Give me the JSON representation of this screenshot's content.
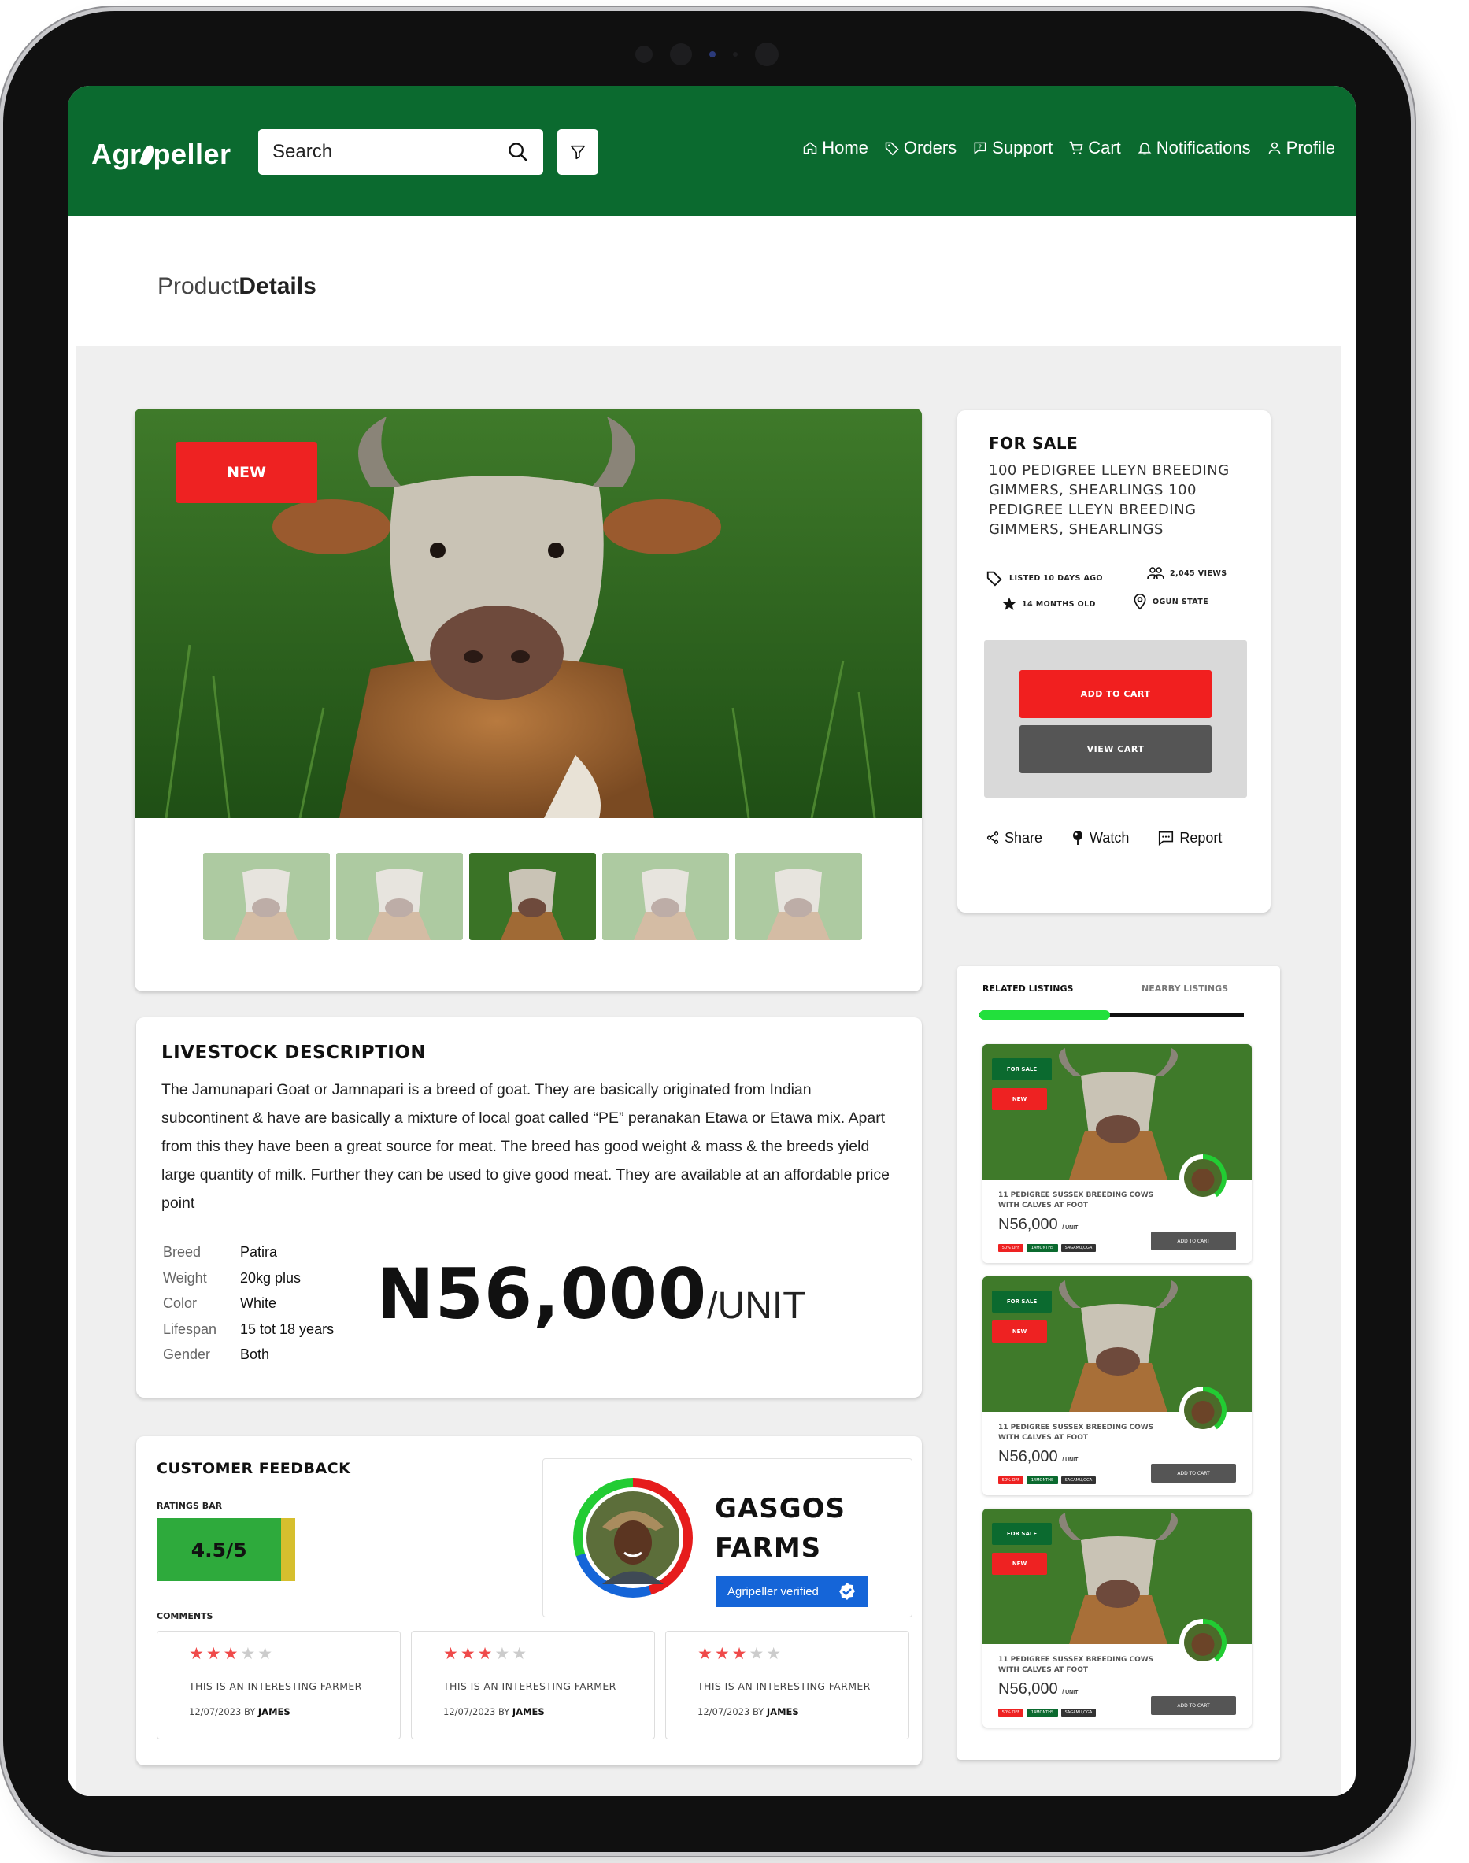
{
  "brand": {
    "logo_left": "Agr",
    "logo_right": "peller"
  },
  "header": {
    "search_placeholder": "Search",
    "nav": [
      {
        "label": "Home",
        "icon": "home-icon"
      },
      {
        "label": "Orders",
        "icon": "tag-icon"
      },
      {
        "label": "Support",
        "icon": "support-icon"
      },
      {
        "label": "Cart",
        "icon": "cart-icon"
      },
      {
        "label": "Notifications",
        "icon": "bell-icon"
      },
      {
        "label": "Profile",
        "icon": "user-icon"
      }
    ]
  },
  "page": {
    "title_light": "Product",
    "title_bold": "Details"
  },
  "gallery": {
    "badge": "NEW",
    "thumbnail_count": 5,
    "selected_thumbnail": 3
  },
  "listing": {
    "status": "FOR SALE",
    "title": "100 PEDIGREE LLEYN BREEDING GIMMERS, SHEARLINGS  100 PEDIGREE LLEYN BREEDING GIMMERS, SHEARLINGS",
    "listed": "LISTED 10 DAYS AGO",
    "views": "2,045 VIEWS",
    "age": "14 MONTHS OLD",
    "location": "OGUN STATE",
    "add_to_cart": "ADD TO CART",
    "view_cart": "VIEW CART",
    "share": "Share",
    "watch": "Watch",
    "report": "Report"
  },
  "description": {
    "heading": "LIVESTOCK DESCRIPTION",
    "text": "The Jamunapari Goat or Jamnapari is a breed of goat. They are basically originated from Indian subcontinent & have are basically a mixture of local goat called “PE” peranakan Etawa or Etawa mix. Apart from this they have been a great source for meat. The breed has good weight & mass & the breeds yield large quantity of milk. Further they can be used to give good meat. They are available at an affordable price point",
    "specs": [
      {
        "key": "Breed",
        "value": "Patira"
      },
      {
        "key": "Weight",
        "value": "20kg plus"
      },
      {
        "key": "Color",
        "value": "White"
      },
      {
        "key": "Lifespan",
        "value": "15 tot 18 years"
      },
      {
        "key": "Gender",
        "value": "Both"
      }
    ],
    "price": "N56,000",
    "unit": "/UNIT"
  },
  "feedback": {
    "heading": "CUSTOMER FEEDBACK",
    "ratings_label": "RATINGS BAR",
    "rating": "4.5/5",
    "rating_fraction": 0.9,
    "comments_label": "COMMENTS",
    "comments": [
      {
        "stars": 3,
        "text": "THIS IS AN INTERESTING FARMER",
        "date": "12/07/2023 BY",
        "author": "JAMES"
      },
      {
        "stars": 3,
        "text": "THIS IS AN INTERESTING FARMER",
        "date": "12/07/2023 BY",
        "author": "JAMES"
      },
      {
        "stars": 3,
        "text": "THIS IS AN INTERESTING FARMER",
        "date": "12/07/2023 BY",
        "author": "JAMES"
      }
    ]
  },
  "seller": {
    "name_line1": "GASGOS",
    "name_line2": "FARMS",
    "verified": "Agripeller verified"
  },
  "related": {
    "tab_active": "RELATED LISTINGS",
    "tab_inactive": "NEARBY LISTINGS",
    "items": [
      {
        "status": "FOR SALE",
        "badge": "NEW",
        "title": "11 PEDIGREE SUSSEX BREEDING COWS WITH CALVES AT FOOT",
        "price": "N56,000",
        "unit": "/ UNIT",
        "button": "ADD TO CART",
        "tags": [
          "50% OFF",
          "14MONTHS",
          "SAGAMU,OGA"
        ]
      },
      {
        "status": "FOR SALE",
        "badge": "NEW",
        "title": "11 PEDIGREE SUSSEX BREEDING COWS WITH CALVES AT FOOT",
        "price": "N56,000",
        "unit": "/ UNIT",
        "button": "ADD TO CART",
        "tags": [
          "50% OFF",
          "14MONTHS",
          "SAGAMU,OGA"
        ]
      },
      {
        "status": "FOR SALE",
        "badge": "NEW",
        "title": "11 PEDIGREE SUSSEX BREEDING COWS WITH CALVES AT FOOT",
        "price": "N56,000",
        "unit": "/ UNIT",
        "button": "ADD TO CART",
        "tags": [
          "50% OFF",
          "14MONTHS",
          "SAGAMU,OGA"
        ]
      }
    ]
  },
  "colors": {
    "brand_green": "#0b6a2f",
    "accent_red": "#ee2222",
    "rating_green": "#2eaa3c",
    "rating_yellow": "#d6bf2e",
    "verified_blue": "#1565d8"
  }
}
